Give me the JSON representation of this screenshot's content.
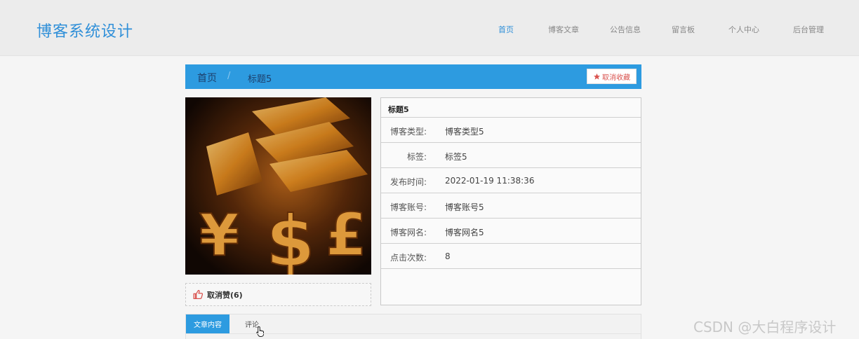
{
  "header": {
    "site_title": "博客系统设计",
    "nav": [
      {
        "label": "首页",
        "active": true
      },
      {
        "label": "博客文章",
        "active": false
      },
      {
        "label": "公告信息",
        "active": false
      },
      {
        "label": "留言板",
        "active": false
      },
      {
        "label": "个人中心",
        "active": false
      },
      {
        "label": "后台管理",
        "active": false
      }
    ]
  },
  "breadcrumb": {
    "home": "首页",
    "separator": "/",
    "current": "标题5",
    "favorite_button": "取消收藏"
  },
  "like": {
    "label": "取消赞(6)"
  },
  "details": {
    "title": "标题5",
    "rows": [
      {
        "label": "博客类型:",
        "value": "博客类型5"
      },
      {
        "label": "标签:",
        "value": "标签5"
      },
      {
        "label": "发布时间:",
        "value": "2022-01-19 11:38:36"
      },
      {
        "label": "博客账号:",
        "value": "博客账号5"
      },
      {
        "label": "博客网名:",
        "value": "博客网名5"
      },
      {
        "label": "点击次数:",
        "value": "8"
      }
    ]
  },
  "tabs": [
    {
      "label": "文章内容",
      "active": true
    },
    {
      "label": "评论",
      "active": false
    }
  ],
  "watermark": "CSDN @大白程序设计",
  "colors": {
    "accent": "#2d9be0",
    "title": "#2f8fd8",
    "favorite": "#d9534f"
  }
}
